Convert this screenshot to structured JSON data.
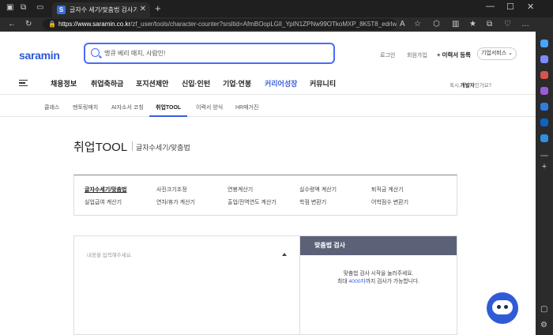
{
  "browser": {
    "tab_title": "글자수 세기/맞춤법 검사기 - 사람인",
    "tab_favicon": "S",
    "url_host": "https://www.saramin.co.kr",
    "url_path": "/zf_user/tools/character-counter?srsltid=AfmBOopLGlI_YpIN1ZPNw99OTkoMXP_8K5T8_edrlwQkYZt4U0H5...",
    "icons": [
      "back-icon",
      "refresh-icon",
      "read-aloud-icon",
      "favorite-icon",
      "extensions-icon",
      "split-screen-icon",
      "favorites-icon",
      "collections-icon",
      "profile-icon",
      "more-icon"
    ]
  },
  "header": {
    "logo": "saramin",
    "search_placeholder": "맹큐 베리 매치, 사람인!",
    "login": "로그인",
    "signup": "회원가입",
    "resume_register": "+ 이력서 등록",
    "corp_service": "기업서비스 ⌄"
  },
  "gnb": {
    "items": [
      "채용정보",
      "취업축하금",
      "포지션제안",
      "신입·인턴",
      "기업·연봉",
      "커리어성장",
      "커뮤니티"
    ],
    "active_index": 5,
    "right_prefix": "혹시,",
    "right_bold": "개발자",
    "right_suffix": "인가요?"
  },
  "lnb": {
    "items": [
      "클래스",
      "멘토링매치",
      "AI자소서 코칭",
      "취업TOOL",
      "이력서 양식",
      "HR매거진"
    ],
    "active_index": 3
  },
  "page": {
    "title": "취업TOOL",
    "subtitle": "글자수세기/맞춤법"
  },
  "tools": {
    "row1": [
      "글자수세기/맞춤법",
      "사진크기조정",
      "연봉계산기",
      "실수령액 계산기",
      "퇴직금 계산기"
    ],
    "row2": [
      "실업급여 계산기",
      "연차/휴가 계산기",
      "출업/전역연도 계산기",
      "학점 변환기",
      "어학점수 변환기"
    ]
  },
  "editor": {
    "placeholder": "내용을 입력해주세요."
  },
  "spellcheck": {
    "header": "맞춤법 검사",
    "msg_line1": "맞춤법 검사 시작을 눌러주세요.",
    "msg_line2_prefix": "최대 ",
    "msg_line2_highlight": "4000자",
    "msg_line2_suffix": "까지 검사가 가능합니다."
  },
  "colors": {
    "brand": "#2b59d8",
    "accent": "#3a5fd9",
    "panel_header": "#5b6278"
  }
}
